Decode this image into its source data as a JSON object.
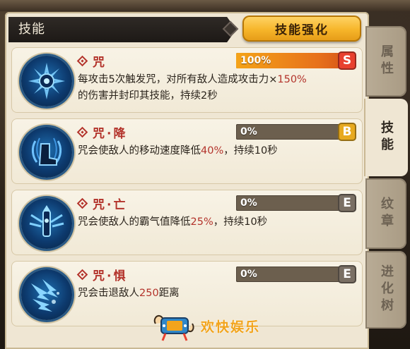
{
  "header": {
    "title": "技能",
    "enhance_button": "技能强化"
  },
  "tabs": [
    {
      "label": "属性",
      "active": false
    },
    {
      "label": "技能",
      "active": true
    },
    {
      "label": "纹章",
      "active": false
    },
    {
      "label": "进化树",
      "active": false
    }
  ],
  "skills": [
    {
      "name": "咒",
      "progress_text": "100%",
      "progress": 1.0,
      "grade": "S",
      "grade_color": "#e8402e",
      "icon": "curse-orb-icon",
      "desc": [
        {
          "t": "每攻击5次触发咒，对所有敌人造成攻击力×",
          "hl": false
        },
        {
          "t": "150%",
          "hl": true
        },
        {
          "t": "的伤害并封印其技能，持续2秒",
          "hl": false
        }
      ]
    },
    {
      "name": "咒·降",
      "progress_text": "0%",
      "progress": 0,
      "grade": "B",
      "grade_color": "#e7a91f",
      "icon": "slow-boot-icon",
      "desc": [
        {
          "t": "咒会使敌人的移动速度降低",
          "hl": false
        },
        {
          "t": "40%",
          "hl": true
        },
        {
          "t": "，持续10秒",
          "hl": false
        }
      ]
    },
    {
      "name": "咒·亡",
      "progress_text": "0%",
      "progress": 0,
      "grade": "E",
      "grade_color": "#7a6f64",
      "icon": "spirit-drain-icon",
      "desc": [
        {
          "t": "咒会使敌人的霸气值降低",
          "hl": false
        },
        {
          "t": "25%",
          "hl": true
        },
        {
          "t": "，持续10秒",
          "hl": false
        }
      ]
    },
    {
      "name": "咒·惧",
      "progress_text": "0%",
      "progress": 0,
      "grade": "E",
      "grade_color": "#7a6f64",
      "icon": "knockback-arrows-icon",
      "desc": [
        {
          "t": "咒会击退敌人",
          "hl": false
        },
        {
          "t": "250",
          "hl": true
        },
        {
          "t": "距离",
          "hl": false
        }
      ]
    }
  ],
  "watermark": {
    "text": "欢快娱乐",
    "icon": "gamepad-hands-icon"
  }
}
